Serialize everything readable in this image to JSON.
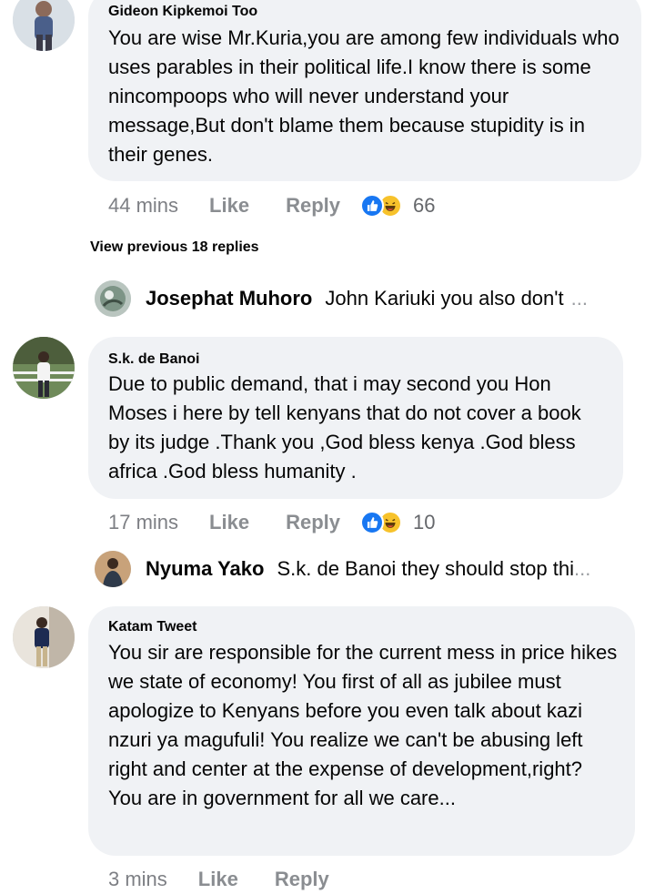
{
  "comments": [
    {
      "author": "Gideon Kipkemoi Too",
      "text": "You are wise Mr.Kuria,you are among few individuals who uses parables in their political life.I know there is some nincompoops who will never understand your message,But don't blame them because stupidity is in their genes.",
      "time": "44 mins",
      "like_label": "Like",
      "reply_label": "Reply",
      "reactions": [
        "like-icon",
        "haha-icon"
      ],
      "reaction_count": "66"
    },
    {
      "author": "S.k. de Banoi",
      "text": "Due to public demand, that i may second you Hon Moses i here by tell kenyans that do not cover a book by its judge .Thank you ,God bless kenya .God bless africa .God bless humanity .",
      "time": "17 mins",
      "like_label": "Like",
      "reply_label": "Reply",
      "reactions": [
        "like-icon",
        "haha-icon"
      ],
      "reaction_count": "10"
    },
    {
      "author": "Katam Tweet",
      "text": "You sir are responsible for the current mess in price hikes we state of economy! You first of all as jubilee must apologize to Kenyans before you even talk about kazi nzuri ya magufuli! You realize we can't be abusing left right and center at the expense of development,right? You are in government for all we care...",
      "time": "3 mins",
      "like_label": "Like",
      "reply_label": "Reply"
    }
  ],
  "view_previous_replies": "View previous 18 replies",
  "replies": [
    {
      "author": "Josephat Muhoro",
      "snippet": "John Kariuki you also don't",
      "ellipsis": "..."
    },
    {
      "author": "Nyuma Yako",
      "snippet": "S.k. de Banoi they should stop thi",
      "ellipsis": "..."
    }
  ],
  "colors": {
    "bubble": "#f0f2f5",
    "like_blue": "#1877f2",
    "haha_yellow": "#f7c22b",
    "meta_grey": "#65676b"
  }
}
